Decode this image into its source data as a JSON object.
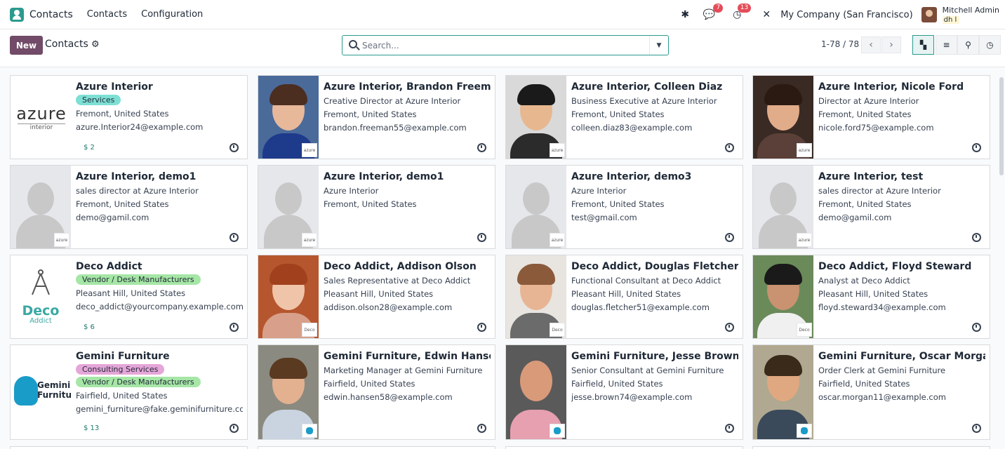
{
  "navbar": {
    "app_name": "Contacts",
    "menu": [
      "Contacts",
      "Configuration"
    ],
    "messages_count": "7",
    "activities_count": "13",
    "company": "My Company (San Francisco)",
    "user_name": "Mitchell Admin",
    "user_db": "dh l"
  },
  "control": {
    "new_label": "New",
    "breadcrumb": "Contacts",
    "search_placeholder": "Search...",
    "pager": "1-78 / 78"
  },
  "cards": [
    {
      "name": "Azure Interior",
      "tags": [
        "Services"
      ],
      "lines": [
        "Fremont, United States",
        "azure.Interior24@example.com"
      ],
      "dollar": "$ 2"
    },
    {
      "name": "Azure Interior, Brandon Freeman",
      "lines": [
        "Creative Director at Azure Interior",
        "Fremont, United States",
        "brandon.freeman55@example.com"
      ]
    },
    {
      "name": "Azure Interior, Colleen Diaz",
      "lines": [
        "Business Executive at Azure Interior",
        "Fremont, United States",
        "colleen.diaz83@example.com"
      ]
    },
    {
      "name": "Azure Interior, Nicole Ford",
      "lines": [
        "Director at Azure Interior",
        "Fremont, United States",
        "nicole.ford75@example.com"
      ]
    },
    {
      "name": "Azure Interior, demo1",
      "lines": [
        "sales director at Azure Interior",
        "Fremont, United States",
        "demo@gamil.com"
      ]
    },
    {
      "name": "Azure Interior, demo1",
      "lines": [
        "Azure Interior",
        "Fremont, United States"
      ]
    },
    {
      "name": "Azure Interior, demo3",
      "lines": [
        "Azure Interior",
        "Fremont, United States",
        "test@gmail.com"
      ]
    },
    {
      "name": "Azure Interior, test",
      "lines": [
        "sales director at Azure Interior",
        "Fremont, United States",
        "demo@gamil.com"
      ]
    },
    {
      "name": "Deco Addict",
      "tags": [
        "Vendor / Desk Manufacturers"
      ],
      "lines": [
        "Pleasant Hill, United States",
        "deco_addict@yourcompany.example.com"
      ],
      "dollar": "$ 6"
    },
    {
      "name": "Deco Addict, Addison Olson",
      "lines": [
        "Sales Representative at Deco Addict",
        "Pleasant Hill, United States",
        "addison.olson28@example.com"
      ]
    },
    {
      "name": "Deco Addict, Douglas Fletcher",
      "lines": [
        "Functional Consultant at Deco Addict",
        "Pleasant Hill, United States",
        "douglas.fletcher51@example.com"
      ]
    },
    {
      "name": "Deco Addict, Floyd Steward",
      "lines": [
        "Analyst at Deco Addict",
        "Pleasant Hill, United States",
        "floyd.steward34@example.com"
      ]
    },
    {
      "name": "Gemini Furniture",
      "tags": [
        "Consulting Services",
        "Vendor / Desk Manufacturers"
      ],
      "lines": [
        "Fairfield, United States",
        "gemini_furniture@fake.geminifurniture.com"
      ],
      "dollar": "$ 13"
    },
    {
      "name": "Gemini Furniture, Edwin Hansen",
      "lines": [
        "Marketing Manager at Gemini Furniture",
        "Fairfield, United States",
        "edwin.hansen58@example.com"
      ]
    },
    {
      "name": "Gemini Furniture, Jesse Brown",
      "lines": [
        "Senior Consultant at Gemini Furniture",
        "Fairfield, United States",
        "jesse.brown74@example.com"
      ]
    },
    {
      "name": "Gemini Furniture, Oscar Morgan",
      "lines": [
        "Order Clerk at Gemini Furniture",
        "Fairfield, United States",
        "oscar.morgan11@example.com"
      ]
    }
  ],
  "logos": {
    "azure_main": "azure",
    "azure_sub": "interior",
    "azure_mini": "azure",
    "deco_main": "Deco",
    "deco_sub": "Addict",
    "deco_mini": "Deco",
    "gemini_main": "Gemini\nFurniture"
  }
}
